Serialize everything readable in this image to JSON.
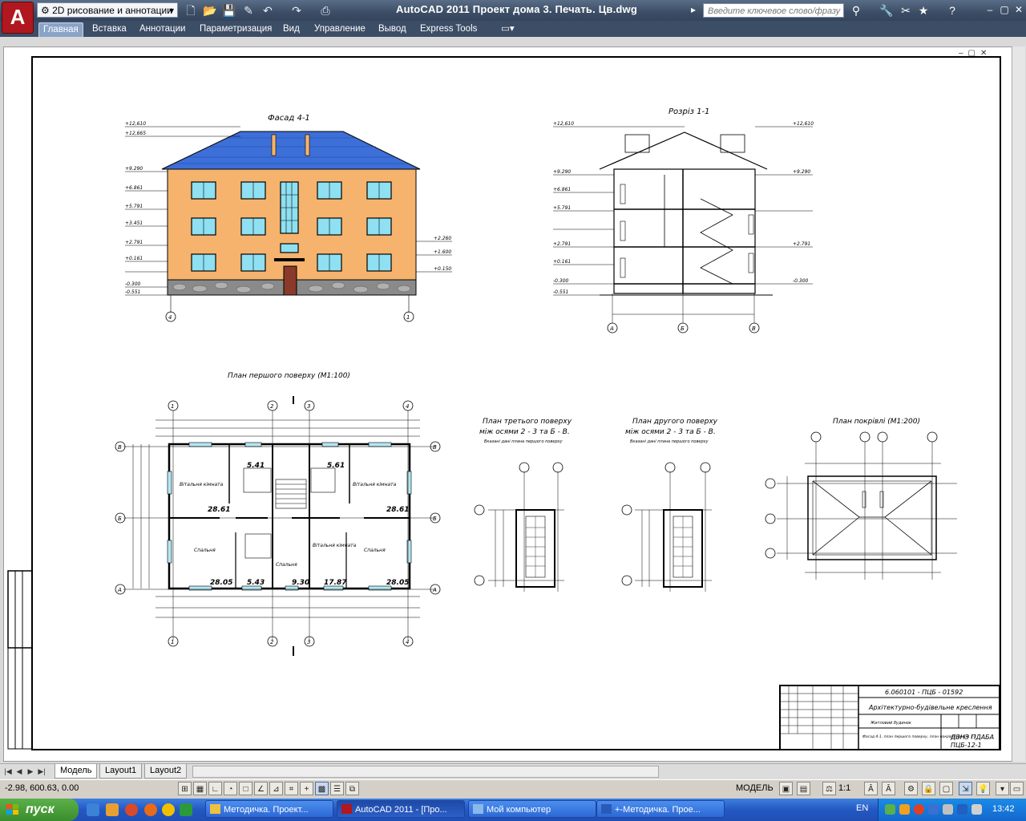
{
  "app": {
    "logo_letter": "A",
    "workspace": "2D рисование и аннотации",
    "title": "AutoCAD 2011    Проект дома 3. Печать. Цв.dwg",
    "search_placeholder": "Введите ключевое слово/фразу"
  },
  "ribbon_tabs": [
    "Главная",
    "Вставка",
    "Аннотации",
    "Параметризация",
    "Вид",
    "Управление",
    "Вывод",
    "Express Tools"
  ],
  "drawing": {
    "facade_title": "Фасад 4-1",
    "section_title": "Розріз 1-1",
    "plan1_title": "План першого поверху (М1:100)",
    "plan3_title": "План третього поверху",
    "plan3_sub": "між осями 2 - 3 та Б - В.",
    "plan3_note": "Вказані дані плана першого поверху",
    "plan2_title": "План другого поверху",
    "plan2_sub": "між осями 2 - 3 та Б - В.",
    "plan2_note": "Вказані дані плана першого поверху",
    "roof_title": "План покрівлі (М1:200)",
    "axes_h": [
      "4",
      "1"
    ],
    "axes_sec": [
      "А",
      "Б",
      "В"
    ],
    "axes_plan_x": [
      "1",
      "2",
      "3",
      "4"
    ],
    "axes_plan_y": [
      "В",
      "Б",
      "А"
    ],
    "room_areas": [
      "5.41",
      "5.61",
      "28.61",
      "28.61",
      "28.05",
      "5.43",
      "9.30",
      "17.87",
      "28.05"
    ],
    "room_names": [
      "Вітальня кімната",
      "Вітальня кімната",
      "Спальня",
      "Спальня",
      "Вітальня кімната",
      "Спальня"
    ],
    "elevations": [
      "+12,610",
      "+12,665",
      "+9.290",
      "+6.861",
      "+5.791",
      "+3.451",
      "+2.791",
      "+0.161",
      "-0.300",
      "-0.551",
      "+2.260",
      "+1.600",
      "+0.150"
    ],
    "title_block": {
      "code": "6.060101 - ПЦБ - 01592",
      "subject": "Архітектурно-будівельне креслення",
      "object": "Житловий будинок",
      "sheet_desc": "Фасад 4-1, план першого поверху, план покрівлі, розріз 1-1",
      "org": "ДВНЗ ПДАБА",
      "group": "ПЦБ-12-1"
    }
  },
  "layout_tabs": [
    "Модель",
    "Layout1",
    "Layout2"
  ],
  "status": {
    "coords": "-2.98, 600.63, 0.00",
    "model_label": "МОДЕЛЬ",
    "scale": "1:1"
  },
  "taskbar": {
    "start": "пуск",
    "tasks": [
      "Методичка. Проект...",
      "AutoCAD 2011 - [Про...",
      "Мой компьютер",
      "+-Методичка. Прое..."
    ],
    "lang": "EN",
    "clock": "13:42"
  },
  "colors": {
    "wall": "#f5b36e",
    "roof": "#3d6fd8",
    "window": "#8ee0f2",
    "plinth": "#7a7a7a",
    "door": "#8a3a2a"
  }
}
